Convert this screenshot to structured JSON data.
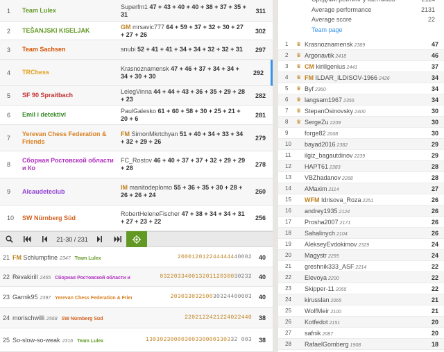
{
  "colors": {
    "title": "#bf811d",
    "accent": "#3692e7",
    "pager_green": "#629924"
  },
  "teams": [
    {
      "rank": "1",
      "name": "Team Lulex",
      "color": "#629924",
      "title": "",
      "leader": "Superfm1",
      "points": "47 + 43 + 40 + 40 + 38 + 37 + 35 + 31",
      "score": "311"
    },
    {
      "rank": "2",
      "name": "TEŠANJSKI KISELJAK",
      "color": "#629924",
      "title": "GM",
      "leader": "mrsavic777",
      "points": "64 + 59 + 37 + 32 + 30 + 27 + 27 + 26",
      "score": "302"
    },
    {
      "rank": "3",
      "name": "Team Sachsen",
      "color": "#d85000",
      "title": "",
      "leader": "snubi",
      "points": "52 + 41 + 41 + 34 + 34 + 32 + 32 + 31",
      "score": "297"
    },
    {
      "rank": "4",
      "name": "TRChess",
      "color": "#e0a020",
      "title": "",
      "leader": "Krasnoznamensk",
      "points": "47 + 46 + 37 + 34 + 34 + 34 + 30 + 30",
      "score": "292"
    },
    {
      "rank": "5",
      "name": "SF 90 Spraitbach",
      "color": "#c33030",
      "title": "",
      "leader": "LelegVinna",
      "points": "44 + 44 + 43 + 36 + 35 + 29 + 28 + 23",
      "score": "282"
    },
    {
      "rank": "6",
      "name": "Emil i detektivi",
      "color": "#3a8a2a",
      "title": "",
      "leader": "PaulGalesko",
      "points": "61 + 60 + 58 + 30 + 25 + 21 + 20 + 6",
      "score": "281"
    },
    {
      "rank": "7",
      "name": "Yerevan Chess Federation & Friends",
      "color": "#d88020",
      "title": "FM",
      "leader": "SimonMkrtchyan",
      "points": "51 + 40 + 34 + 33 + 34 + 32 + 29 + 26",
      "score": "279"
    },
    {
      "rank": "8",
      "name": "Сборная Ростовской области и Ко",
      "color": "#b030c0",
      "title": "",
      "leader": "FC_Rostov",
      "points": "46 + 40 + 37 + 37 + 32 + 29 + 29 + 28",
      "score": "278"
    },
    {
      "rank": "9",
      "name": "Alcaudeteclub",
      "color": "#9040d0",
      "title": "IM",
      "leader": "manitodeplomo",
      "points": "55 + 36 + 35 + 30 + 28 + 26 + 26 + 24",
      "score": "260"
    },
    {
      "rank": "10",
      "name": "SW Nürnberg Süd",
      "color": "#d06020",
      "title": "",
      "leader": "RobertHeleneFischer",
      "points": "47 + 38 + 34 + 34 + 31 + 27 + 23 + 22",
      "score": "256"
    }
  ],
  "pager": {
    "range": "21-30 / 231"
  },
  "players": [
    {
      "rank": "21",
      "title": "FM",
      "name": "Schlumpfine",
      "rating": "2347",
      "team": "Team Lulex",
      "team_color": "#629924",
      "scores_hi": "2000120122444444",
      "scores_lo": "40002",
      "points": "40"
    },
    {
      "rank": "22",
      "title": "",
      "name": "Revakirill",
      "rating": "2455",
      "team": "Сборная Ростовской области и Ко",
      "team_color": "#b030c0",
      "scores_hi": "032203340013201120300",
      "scores_lo": "30232",
      "points": "40"
    },
    {
      "rank": "23",
      "title": "",
      "name": "Garnik95",
      "rating": "2397",
      "team": "Yerevan Chess Federation & Friends",
      "team_color": "#d88020",
      "scores_hi": "203033032500",
      "scores_lo": "30324400003",
      "points": "40"
    },
    {
      "rank": "24",
      "title": "",
      "name": "morischwilli",
      "rating": "2568",
      "team": "SW Nürnberg Süd",
      "team_color": "#d06020",
      "scores_hi": "2202122421224022440",
      "scores_lo": "",
      "points": "38"
    },
    {
      "rank": "25",
      "title": "",
      "name": "So-slow-so-weak",
      "rating": "2316",
      "team": "Team Lulex",
      "team_color": "#629924",
      "scores_hi": "130302300003003300003303",
      "scores_lo": "32 003",
      "points": "38"
    }
  ],
  "team_stats": [
    {
      "label": "Средний рейтинг участников",
      "value": "2114"
    },
    {
      "label": "Average performance",
      "value": "2131"
    },
    {
      "label": "Average score",
      "value": "22"
    }
  ],
  "team_page_link": "Team page",
  "roster": [
    {
      "rank": "1",
      "crown": true,
      "title": "",
      "name": "Krasnoznamensk",
      "rating": "2389",
      "points": "47"
    },
    {
      "rank": "2",
      "crown": true,
      "title": "",
      "name": "Argonavtik",
      "rating": "2418",
      "points": "46"
    },
    {
      "rank": "3",
      "crown": true,
      "title": "CM",
      "name": "kirillgenius",
      "rating": "2441",
      "points": "37"
    },
    {
      "rank": "4",
      "crown": true,
      "title": "FM",
      "name": "ILDAR_ILDISOV-1966",
      "rating": "2426",
      "points": "34"
    },
    {
      "rank": "5",
      "crown": true,
      "title": "",
      "name": "Byf",
      "rating": "2360",
      "points": "34"
    },
    {
      "rank": "6",
      "crown": true,
      "title": "",
      "name": "langsam1967",
      "rating": "2355",
      "points": "34"
    },
    {
      "rank": "7",
      "crown": true,
      "title": "",
      "name": "StepanOsinovsky",
      "rating": "2400",
      "points": "30"
    },
    {
      "rank": "8",
      "crown": true,
      "title": "",
      "name": "SergeZu",
      "rating": "2209",
      "points": "30"
    },
    {
      "rank": "9",
      "crown": false,
      "title": "",
      "name": "forge82",
      "rating": "2008",
      "points": "30"
    },
    {
      "rank": "10",
      "crown": false,
      "title": "",
      "name": "bayad2016",
      "rating": "2382",
      "points": "29"
    },
    {
      "rank": "11",
      "crown": false,
      "title": "",
      "name": "ilgiz_bagautdinov",
      "rating": "2239",
      "points": "29"
    },
    {
      "rank": "12",
      "crown": false,
      "title": "",
      "name": "HAPT61",
      "rating": "2383",
      "points": "28"
    },
    {
      "rank": "13",
      "crown": false,
      "title": "",
      "name": "VBZhadanov",
      "rating": "2268",
      "points": "28"
    },
    {
      "rank": "14",
      "crown": false,
      "title": "",
      "name": "AMaxim",
      "rating": "2114",
      "points": "27"
    },
    {
      "rank": "15",
      "crown": false,
      "title": "WFM",
      "name": "Idrisova_Roza",
      "rating": "2251",
      "points": "26"
    },
    {
      "rank": "16",
      "crown": false,
      "title": "",
      "name": "andrey1935",
      "rating": "2124",
      "points": "26"
    },
    {
      "rank": "17",
      "crown": false,
      "title": "",
      "name": "Prosha2007",
      "rating": "2171",
      "points": "26"
    },
    {
      "rank": "18",
      "crown": false,
      "title": "",
      "name": "Sahalinych",
      "rating": "2104",
      "points": "26"
    },
    {
      "rank": "19",
      "crown": false,
      "title": "",
      "name": "AlekseyEvdokimov",
      "rating": "2329",
      "points": "24"
    },
    {
      "rank": "20",
      "crown": false,
      "title": "",
      "name": "Magystr",
      "rating": "2295",
      "points": "24"
    },
    {
      "rank": "21",
      "crown": false,
      "title": "",
      "name": "greshnik333_ASF",
      "rating": "2214",
      "points": "22"
    },
    {
      "rank": "22",
      "crown": false,
      "title": "",
      "name": "Elevoya",
      "rating": "2200",
      "points": "22"
    },
    {
      "rank": "23",
      "crown": false,
      "title": "",
      "name": "Skipper-11",
      "rating": "2055",
      "points": "22"
    },
    {
      "rank": "24",
      "crown": false,
      "title": "",
      "name": "kirusslan",
      "rating": "2065",
      "points": "21"
    },
    {
      "rank": "25",
      "crown": false,
      "title": "",
      "name": "WolfMeir",
      "rating": "2100",
      "points": "21"
    },
    {
      "rank": "26",
      "crown": false,
      "title": "",
      "name": "Kotfedot",
      "rating": "2151",
      "points": "20"
    },
    {
      "rank": "27",
      "crown": false,
      "title": "",
      "name": "safnik",
      "rating": "2087",
      "points": "20"
    },
    {
      "rank": "28",
      "crown": false,
      "title": "",
      "name": "RafaelGomberg",
      "rating": "1908",
      "points": "18"
    }
  ]
}
